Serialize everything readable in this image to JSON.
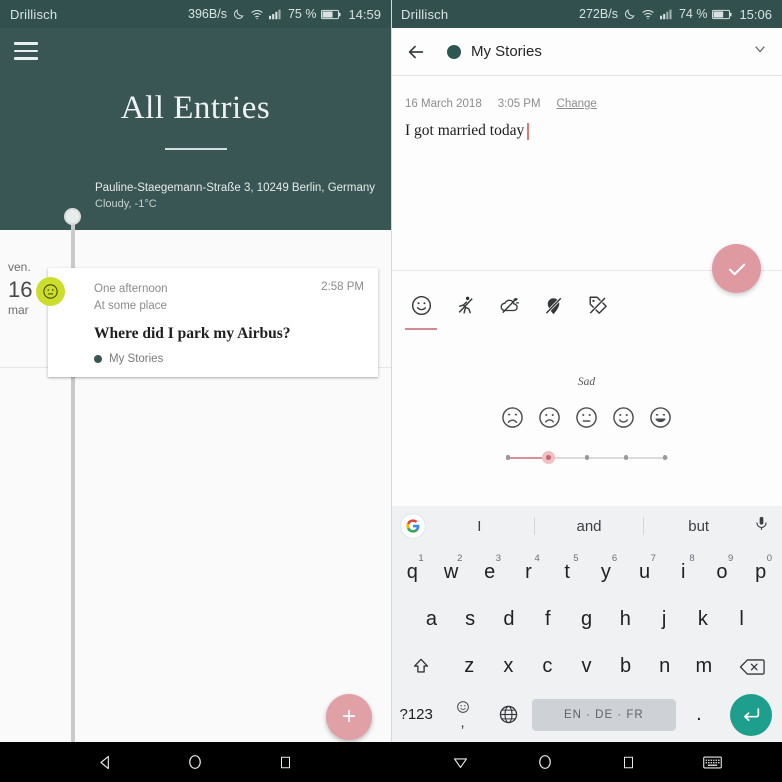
{
  "status_left": {
    "carrier": "Drillisch",
    "data_rate": "396B/s",
    "battery_pct": "75 %",
    "time": "14:59",
    "icons": [
      "moon-icon",
      "wifi-icon",
      "signal-icon",
      "battery-icon"
    ]
  },
  "status_right": {
    "carrier": "Drillisch",
    "data_rate": "272B/s",
    "battery_pct": "74 %",
    "time": "15:06",
    "icons": [
      "moon-icon",
      "wifi-icon",
      "signal-icon",
      "battery-icon"
    ]
  },
  "left_panel": {
    "menu_icon": "hamburger-icon",
    "title": "All Entries",
    "location": {
      "address": "Pauline-Staegemann-Straße 3, 10249 Berlin, Germany",
      "weather": "Cloudy, -1°C"
    },
    "date_column": {
      "weekday": "ven.",
      "day": "16",
      "month": "mar"
    },
    "entry": {
      "when": "One afternoon",
      "place": "At some place",
      "time": "2:58 PM",
      "title": "Where did I park my Airbus?",
      "notebook": "My Stories",
      "notebook_color": "#3A5654",
      "mood_badge_color": "#CCDD2B",
      "mood_badge_icon": "neutral-face-icon"
    },
    "fab": {
      "label": "+",
      "name": "add-entry-fab",
      "color": "#E0A0A5"
    }
  },
  "right_panel": {
    "appbar": {
      "back_icon": "back-arrow-icon",
      "notebook": "My Stories",
      "notebook_color": "#2F5653",
      "dropdown_icon": "chevron-down-icon"
    },
    "meta": {
      "date": "16 March 2018",
      "time": "3:05 PM",
      "change_label": "Change"
    },
    "body_text": "I got married today",
    "save_fab": {
      "icon": "check-icon",
      "color": "#DE9AA0"
    },
    "tabs": [
      {
        "name": "tab-mood",
        "icon": "smiley-icon",
        "active": true
      },
      {
        "name": "tab-activity",
        "icon": "activity-off-icon",
        "active": false
      },
      {
        "name": "tab-weather",
        "icon": "weather-off-icon",
        "active": false
      },
      {
        "name": "tab-location",
        "icon": "location-off-icon",
        "active": false
      },
      {
        "name": "tab-tag",
        "icon": "tag-off-icon",
        "active": false
      }
    ],
    "mood": {
      "label": "Sad",
      "selected_index": 1,
      "options": [
        "very-sad-face",
        "sad-face",
        "neutral-face",
        "happy-face",
        "very-happy-face"
      ],
      "accent_color": "#D2898F"
    }
  },
  "keyboard": {
    "google_icon": "google-logo-icon",
    "mic_icon": "microphone-icon",
    "suggestions": [
      "I",
      "and",
      "but"
    ],
    "row1": [
      {
        "key": "q",
        "num": "1"
      },
      {
        "key": "w",
        "num": "2"
      },
      {
        "key": "e",
        "num": "3"
      },
      {
        "key": "r",
        "num": "4"
      },
      {
        "key": "t",
        "num": "5"
      },
      {
        "key": "y",
        "num": "6"
      },
      {
        "key": "u",
        "num": "7"
      },
      {
        "key": "i",
        "num": "8"
      },
      {
        "key": "o",
        "num": "9"
      },
      {
        "key": "p",
        "num": "0"
      }
    ],
    "row2": [
      "a",
      "s",
      "d",
      "f",
      "g",
      "h",
      "j",
      "k",
      "l"
    ],
    "row3": {
      "shift_icon": "shift-icon",
      "keys": [
        "z",
        "x",
        "c",
        "v",
        "b",
        "n",
        "m"
      ],
      "backspace_icon": "backspace-icon"
    },
    "row4": {
      "symbols_label": "?123",
      "emoji_icon": "emoji-icon",
      "comma_label": ",",
      "globe_icon": "globe-icon",
      "spacebar_label": "EN · DE · FR",
      "period_label": ".",
      "enter_icon": "enter-icon",
      "enter_color": "#1E9E8D"
    }
  },
  "navbar_left": {
    "back_icon": "nav-back-triangle-icon",
    "home_icon": "nav-home-circle-icon",
    "recents_icon": "nav-recents-square-icon"
  },
  "navbar_right": {
    "dismiss_icon": "nav-keyboard-dismiss-icon",
    "home_icon": "nav-home-circle-icon",
    "recents_icon": "nav-recents-square-icon",
    "keyboard_icon": "nav-keyboard-switch-icon"
  }
}
